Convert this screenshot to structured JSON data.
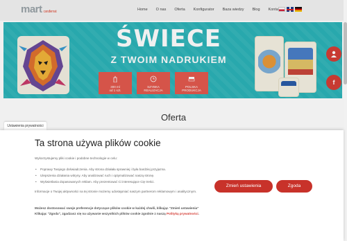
{
  "header": {
    "logo_main": "mart",
    "logo_sub": "candlemat",
    "nav": [
      {
        "label": "Home"
      },
      {
        "label": "O nas"
      },
      {
        "label": "Oferta"
      },
      {
        "label": "Konfigurator"
      },
      {
        "label": "Baza wiedzy"
      },
      {
        "label": "Blog"
      },
      {
        "label": "Kontakt"
      }
    ],
    "languages": [
      "pl",
      "en",
      "de"
    ]
  },
  "banner": {
    "title": "ŚWIECE",
    "subtitle": "Z TWOIM NADRUKIEM",
    "features": [
      {
        "line1": "300 ml",
        "line2": "od 1 szt.",
        "icon": "candle-icon"
      },
      {
        "line1": "SZYBKA",
        "line2": "REALIZACJA",
        "icon": "clock-icon"
      },
      {
        "line1": "POLSKA",
        "line2": "PRODUKCJA",
        "icon": "flag-icon"
      }
    ],
    "colors": {
      "background": "#2bb3b8",
      "feature": "#e35a4e"
    }
  },
  "side_buttons": [
    {
      "icon": "user-icon"
    },
    {
      "icon": "facebook-icon",
      "label": "f"
    }
  ],
  "page": {
    "heading": "Oferta"
  },
  "cookie": {
    "tab_label": "Ustawienia prywatności",
    "title": "Ta strona używa plików cookie",
    "intro": "Wykorzystujemy pliki cookie i podobne technologie w celu:",
    "purposes": [
      "Poprawy Twojego doświadczenia. Aby strona działała sprawniej i była bardziej przyjazna.",
      "Ulepszenia działania witryny. Aby analizować ruch i optymalizować naszą stronę.",
      "Wyświetlania dopasowanych reklam. Aby prezentować Ci interesujące Cię treści."
    ],
    "info": "Informacje o Twojej aktywności na tej stronie możemy udostępniać naszym partnerom reklamowym i analitycznym.",
    "pref_text": "Możesz dostosować swoje preferencje dotyczące plików cookie w każdej chwili, klikając \"Zmień ustawienia\"",
    "consent_text": "Klikając \"Zgoda\", zgadzasz się na używanie wszystkich plików cookie zgodnie z naszą ",
    "policy_link": "Polityką prywatności",
    "consent_end": ".",
    "buttons": {
      "settings": "Zmień ustawienia",
      "agree": "Zgoda"
    },
    "colors": {
      "accent": "#c8322a"
    }
  }
}
